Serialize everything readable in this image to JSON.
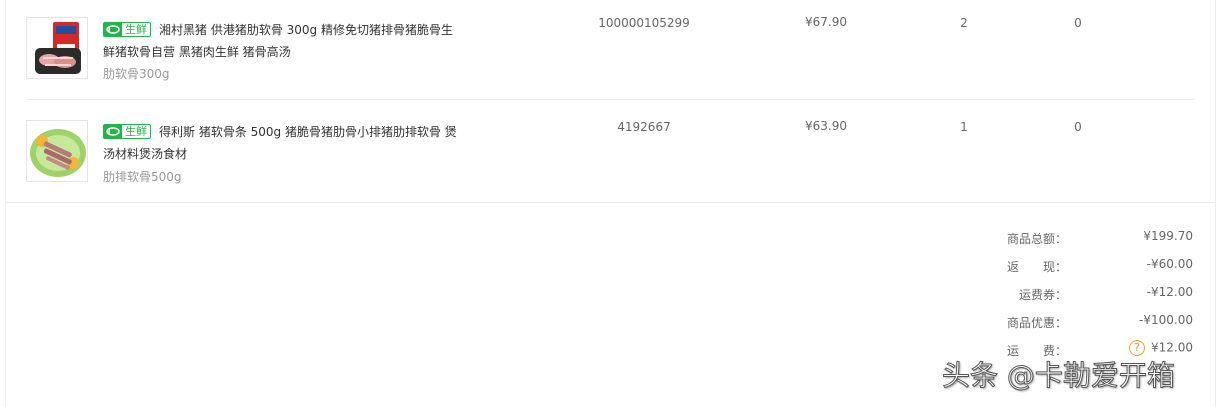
{
  "products": [
    {
      "tag_icon": "fresh-logo-icon",
      "tag_label": "生鲜",
      "title": "湘村黑猪 供港猪肋软骨 300g 精修免切猪排骨猪脆骨生鲜猪软骨自营 黑猪肉生鲜 猪骨高汤",
      "variant": "肋软骨300g",
      "sku": "100000105299",
      "price": "¥67.90",
      "quantity": "2",
      "extra": "0"
    },
    {
      "tag_icon": "fresh-logo-icon",
      "tag_label": "生鲜",
      "title": "得利斯 猪软骨条 500g 猪脆骨猪肋骨小排猪肋排软骨 煲汤材料煲汤食材",
      "variant": "肋排软骨500g",
      "sku": "4192667",
      "price": "¥63.90",
      "quantity": "1",
      "extra": "0"
    }
  ],
  "summary": {
    "total_label": "商品总额：",
    "total_value": "¥199.70",
    "cashback_label": "返　　现：",
    "cashback_value": "-¥60.00",
    "shipping_coupon_label": "运费券：",
    "shipping_coupon_value": "-¥12.00",
    "discount_label": "商品优惠：",
    "discount_value": "-¥100.00",
    "shipping_label": "运　　费：",
    "shipping_value": "¥12.00"
  },
  "watermark": "头条 @卡勒爱开箱",
  "colors": {
    "fresh_green": "#27b24a",
    "help_orange": "#f0a020"
  }
}
